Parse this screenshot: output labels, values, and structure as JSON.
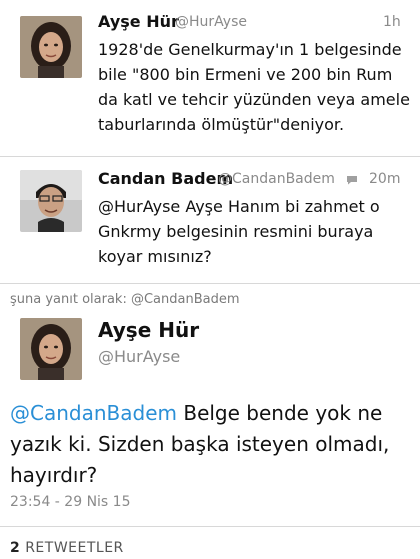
{
  "tweets": [
    {
      "name": "Ayşe Hür",
      "handle": "@HurAyse",
      "time": "1h",
      "lines": [
        "1928'de Genelkurmay'ın 1 belgesinde",
        "bile \"800 bin Ermeni ve 200 bin Rum",
        "da katl ve tehcir yüzünden veya amele",
        "taburlarında ölmüştür\"deniyor."
      ]
    },
    {
      "name": "Candan Badem",
      "handle": "@CandanBadem",
      "time": "20m",
      "lines": [
        "@HurAyse Ayşe Hanım bi zahmet o",
        "Gnkrmy belgesinin resmini buraya",
        "koyar mısınız?"
      ]
    }
  ],
  "reply_context": "şuna yanıt olarak: @CandanBadem",
  "main_tweet": {
    "name": "Ayşe Hür",
    "handle": "@HurAyse",
    "mention": "@CandanBadem",
    "text_line1": " Belge bende yok ne",
    "text_line2": "yazık ki. Sizden başka isteyen olmadı,",
    "text_line3": "hayırdır?",
    "timestamp": "23:54 - 29 Nis 15"
  },
  "retweets": {
    "count": "2",
    "label": "RETWEETLER"
  },
  "icons": {
    "reply": "speech-bubble-icon"
  }
}
